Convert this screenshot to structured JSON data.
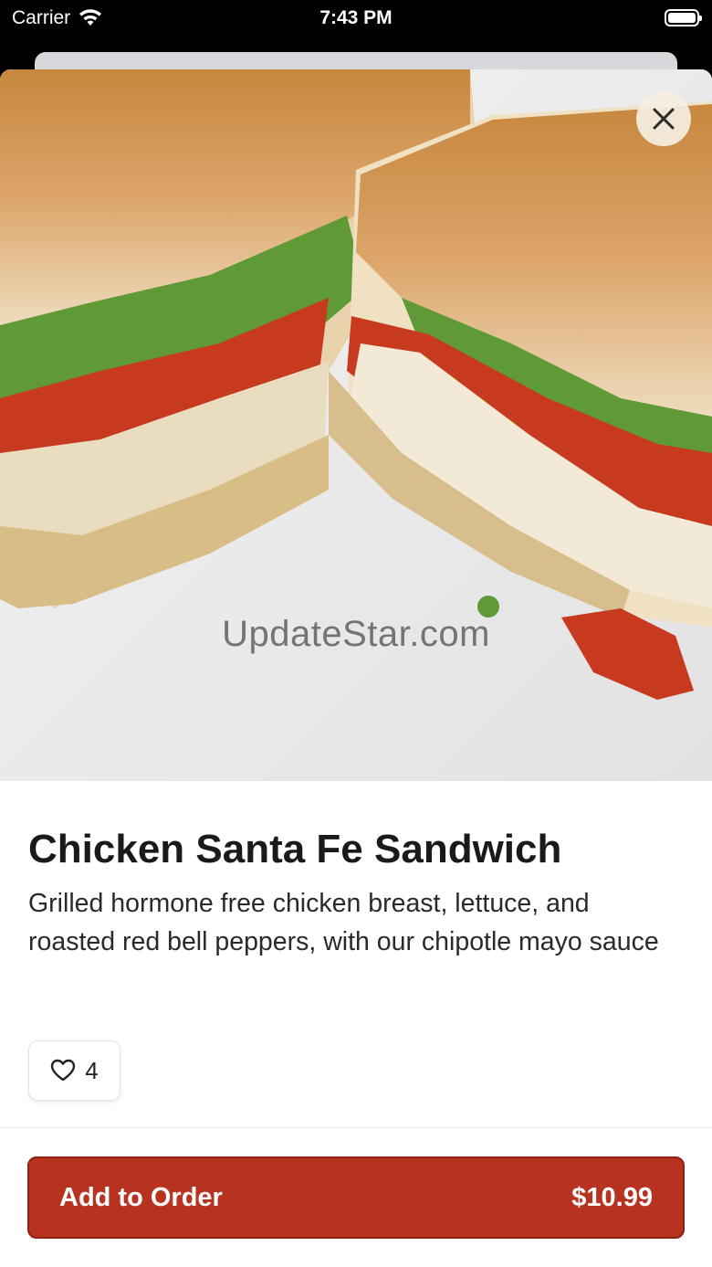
{
  "status_bar": {
    "carrier": "Carrier",
    "time": "7:43 PM"
  },
  "item": {
    "image_alt": "Chicken Santa Fe Sandwich photo",
    "watermark": "UpdateStar.com",
    "title": "Chicken Santa Fe Sandwich",
    "description": "Grilled hormone free chicken breast, lettuce, and roasted red bell peppers, with our chipotle mayo sauce",
    "likes": "4"
  },
  "order": {
    "label": "Add to Order",
    "price": "$10.99"
  },
  "colors": {
    "accent": "#b83220",
    "accent_border": "#8f2012"
  }
}
